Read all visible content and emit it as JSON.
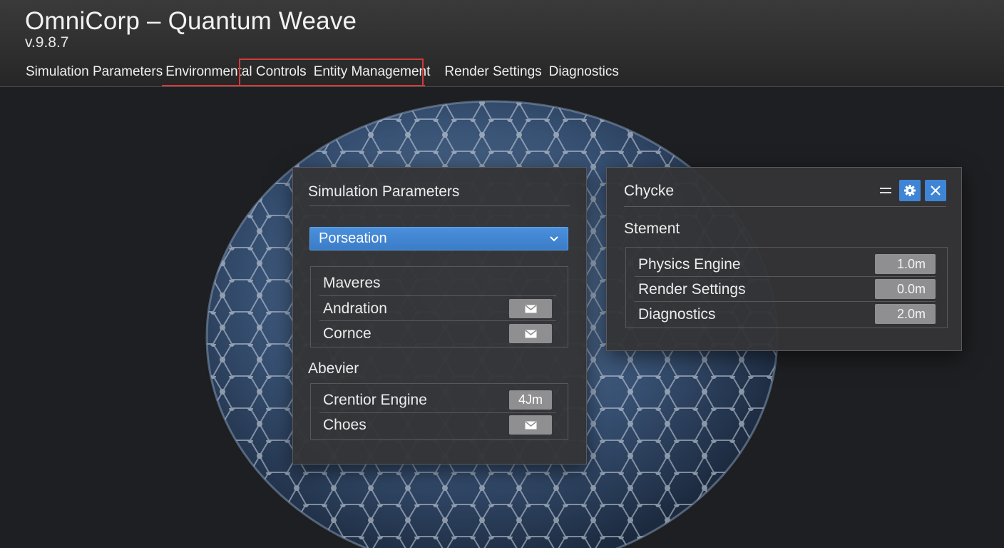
{
  "app": {
    "title": "OmniCorp – Quantum Weave",
    "version": "v.9.8.7"
  },
  "tabs": [
    {
      "label": "Simulation Parameters"
    },
    {
      "label": "Environmental Controls"
    },
    {
      "label": "Entity Management"
    },
    {
      "label": "Render Settings"
    },
    {
      "label": "Diagnostics"
    }
  ],
  "colors": {
    "accent_blue": "#3f85d6",
    "active_tab_outline": "#d23a3a",
    "panel_bg": "#343436"
  },
  "sim_panel": {
    "title": "Simulation Parameters",
    "dropdown": {
      "value": "Porseation",
      "icon": "chevron-down-icon"
    },
    "group1": {
      "header": "Maveres",
      "rows": [
        {
          "label": "Andration",
          "icon": "envelope-icon"
        },
        {
          "label": "Cornce",
          "icon": "envelope-icon"
        }
      ]
    },
    "section_heading": "Abevier",
    "group2": {
      "rows": [
        {
          "label": "Crentior Engine",
          "value": "4Jm"
        },
        {
          "label": "Choes",
          "icon": "envelope-icon"
        }
      ]
    }
  },
  "side_panel": {
    "title": "Chycke",
    "controls": {
      "minimize_icon": "minimize-icon",
      "settings_icon": "gear-icon",
      "close_icon": "close-icon"
    },
    "section_heading": "Stement",
    "rows": [
      {
        "label": "Physics Engine",
        "value": "1.0m"
      },
      {
        "label": "Render Settings",
        "value": "0.0m"
      },
      {
        "label": "Diagnostics",
        "value": "2.0m"
      }
    ]
  }
}
